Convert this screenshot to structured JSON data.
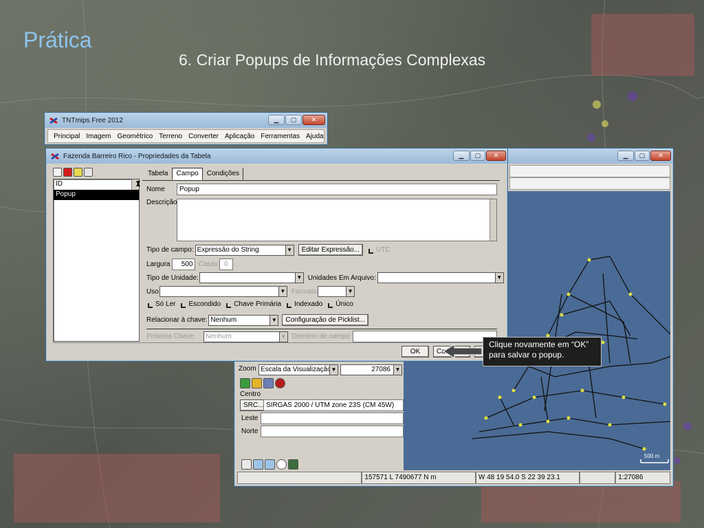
{
  "slide": {
    "title": "Prática",
    "subtitle": "6. Criar Popups de Informações Complexas"
  },
  "tnt_window": {
    "title": "TNTmips Free 2012",
    "menu": [
      "Principal",
      "Imagem",
      "Geométrico",
      "Terreno",
      "Converter",
      "Aplicação",
      "Ferramentas",
      "Ajuda"
    ]
  },
  "props_window": {
    "title": "Fazenda Barreiro Rico - Propriedades da Tabela",
    "fields": [
      "ID",
      "Popup"
    ],
    "selected_field": "Popup",
    "tabs": [
      "Tabela",
      "Campo",
      "Condições"
    ],
    "active_tab": "Campo",
    "name_label": "Nome",
    "name_value": "Popup",
    "desc_label": "Descrição",
    "field_type_label": "Tipo de campo:",
    "field_type_value": "Expressão do String",
    "edit_expression": "Editar Expressão...",
    "utc_label": "UTC",
    "width_label": "Largura",
    "width_value": "500",
    "decimals_label": "Casas",
    "decimals_value": "0",
    "unit_type_label": "Tipo de Unidade:",
    "unit_file_label": "Unidades Em Arquivo:",
    "use_label": "Uso",
    "format_label": "Formato",
    "checkboxes": [
      "Só Ler",
      "Escondido",
      "Chave Primária",
      "Indexado",
      "Único"
    ],
    "relate_label": "Relacionar à chave:",
    "relate_value": "Nenhum",
    "picklist_button": "Configuração de Picklist...",
    "next_key_label": "Próxima Chave:",
    "next_key_value": "Nenhum",
    "domain_label": "Domínio de campo:",
    "ok": "OK",
    "cancel_partial": "Ca",
    "apply_partial": "A"
  },
  "map_window": {
    "zoom_label": "Zoom",
    "zoom_select": "Escala da Visualização",
    "zoom_value": "27086",
    "center_label": "Centro",
    "src_button": "SRC...",
    "crs_value": "SIRGAS 2000 / UTM zone 23S (CM 45W)",
    "east_label": "Leste",
    "north_label": "Norte",
    "scale_bar": "500 m",
    "status_coords": "157571 L 7490677 N m",
    "status_latlon": "W 48 19 54.0  S 22 39 23.1",
    "status_scale": "1:27086"
  },
  "callout": {
    "line1": "Clique novamente em “OK”",
    "line2": "para salvar o popup."
  },
  "colors": {
    "title_blue": "#8fc4ee",
    "map_water": "#4a6b95",
    "callout_bg": "#1e1e1e"
  }
}
